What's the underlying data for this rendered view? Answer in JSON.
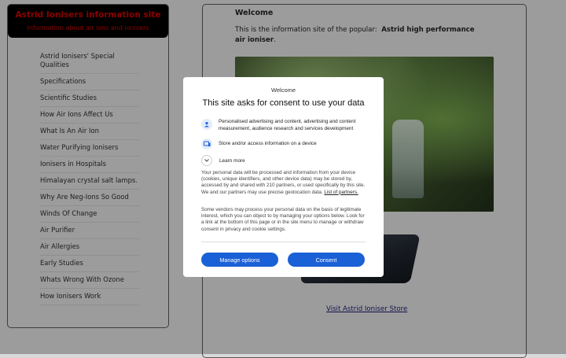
{
  "site": {
    "title": "Astrid Ionisers information site",
    "subtitle": "Information about air ions and ionisers"
  },
  "sidebar": {
    "items": [
      {
        "label": "Astrid Ionisers' Special Qualities"
      },
      {
        "label": "Specifications"
      },
      {
        "label": "Scientific Studies"
      },
      {
        "label": "How Air Ions Affect Us"
      },
      {
        "label": "What Is An Air Ion"
      },
      {
        "label": "Water Purifying Ionisers"
      },
      {
        "label": "Ionisers in Hospitals"
      },
      {
        "label": "Himalayan crystal salt lamps."
      },
      {
        "label": "Why Are Neg-Ions So Good"
      },
      {
        "label": "Winds Of Change"
      },
      {
        "label": "Air Purifier"
      },
      {
        "label": "Air Allergies"
      },
      {
        "label": "Early Studies"
      },
      {
        "label": "Whats Wrong With Ozone"
      },
      {
        "label": "How Ionisers Work"
      }
    ]
  },
  "main": {
    "heading": "Welcome",
    "intro_prefix": "This is the information site of the popular:",
    "intro_bold": "Astrid high performance air ioniser",
    "intro_suffix": ".",
    "store_link": "Visit Astrid Ioniser Store"
  },
  "consent": {
    "brand": "Welcome",
    "title": "This site asks for consent to use your data",
    "purposes": [
      {
        "icon": "person-icon",
        "text": "Personalised advertising and content, advertising and content measurement, audience research and services development"
      },
      {
        "icon": "device-icon",
        "text": "Store and/or access information on a device"
      }
    ],
    "learn_more": "Learn more",
    "paragraph1": "Your personal data will be processed and information from your device (cookies, unique identifiers, and other device data) may be stored by, accessed by and shared with 210 partners, or used specifically by this site. We and our partners may use precise geolocation data.",
    "partners_link": "List of partners.",
    "paragraph2": "Some vendors may process your personal data on the basis of legitimate interest, which you can object to by managing your options below. Look for a link at the bottom of this page or in the site menu to manage or withdraw consent in privacy and cookie settings.",
    "manage_label": "Manage options",
    "consent_label": "Consent"
  },
  "colors": {
    "accent": "#1a60d6",
    "header_text": "#c40000"
  }
}
